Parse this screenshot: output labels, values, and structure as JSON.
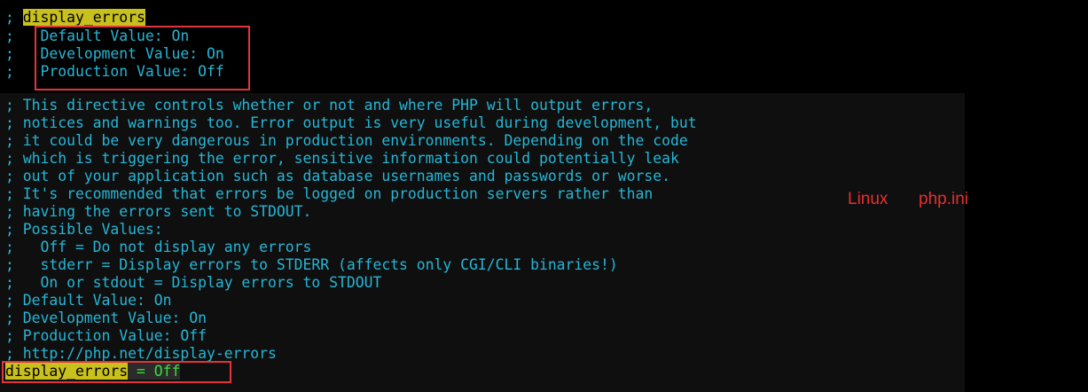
{
  "editor": {
    "top_block": {
      "heading_prefix": "; ",
      "heading": "display_errors",
      "prefix": ";   ",
      "values": [
        "Default Value: On",
        "Development Value: On",
        "Production Value: Off"
      ]
    },
    "comment_lines": [
      "; This directive controls whether or not and where PHP will output errors,",
      "; notices and warnings too. Error output is very useful during development, but",
      "; it could be very dangerous in production environments. Depending on the code",
      "; which is triggering the error, sensitive information could potentially leak",
      "; out of your application such as database usernames and passwords or worse.",
      "; It's recommended that errors be logged on production servers rather than",
      "; having the errors sent to STDOUT.",
      "; Possible Values:",
      ";   Off = Do not display any errors",
      ";   stderr = Display errors to STDERR (affects only CGI/CLI binaries!)",
      ";   On or stdout = Display errors to STDOUT",
      "; Default Value: On",
      "; Development Value: On",
      "; Production Value: Off",
      "; http://php.net/display-errors"
    ],
    "directive": {
      "key": "display_errors",
      "rest": " = Off"
    }
  },
  "annotation": {
    "os": "Linux",
    "file": "php.ini"
  },
  "colors": {
    "comment": "#25b6d6",
    "highlight": "#c8c01c",
    "value": "#3ddb3d",
    "box": "#e0353a"
  }
}
